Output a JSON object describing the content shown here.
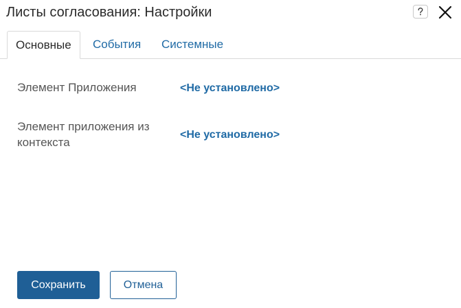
{
  "dialog": {
    "title": "Листы согласования: Настройки",
    "help_icon": "question-icon",
    "close_icon": "close-icon"
  },
  "tabs": [
    {
      "label": "Основные",
      "active": true
    },
    {
      "label": "События",
      "active": false
    },
    {
      "label": "Системные",
      "active": false
    }
  ],
  "fields": [
    {
      "label": "Элемент Приложения",
      "value": "<Не установлено>"
    },
    {
      "label": "Элемент приложения из контекста",
      "value": "<Не установлено>"
    }
  ],
  "buttons": {
    "save_label": "Сохранить",
    "cancel_label": "Отмена"
  },
  "colors": {
    "accent": "#1f5f96",
    "link": "#1f6aa5",
    "text": "#2a2a2a",
    "label": "#555555",
    "border": "#d9d9d9"
  }
}
